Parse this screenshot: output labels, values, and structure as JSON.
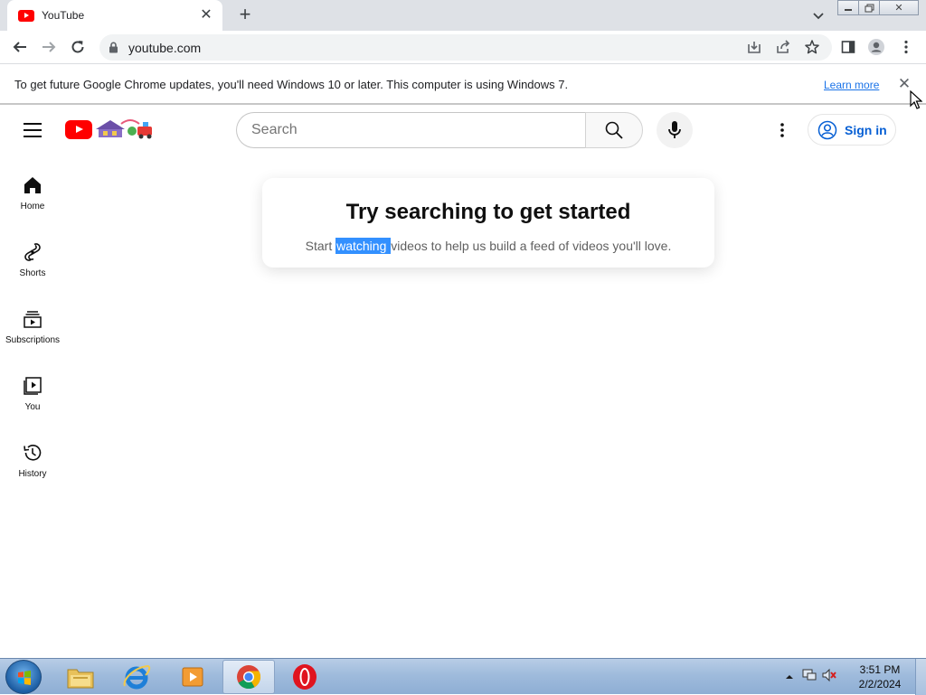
{
  "browser": {
    "tab": {
      "title": "YouTube"
    },
    "address": {
      "url": "youtube.com"
    }
  },
  "infobar": {
    "message": "To get future Google Chrome updates, you'll need Windows 10 or later. This computer is using Windows 7.",
    "learn_more": "Learn more"
  },
  "youtube": {
    "search": {
      "placeholder": "Search"
    },
    "sign_in": "Sign in",
    "nav": [
      {
        "label": "Home",
        "icon": "home-icon"
      },
      {
        "label": "Shorts",
        "icon": "shorts-icon"
      },
      {
        "label": "Subscriptions",
        "icon": "subscriptions-icon"
      },
      {
        "label": "You",
        "icon": "you-icon"
      },
      {
        "label": "History",
        "icon": "history-icon"
      }
    ],
    "card": {
      "title": "Try searching to get started",
      "sub_before": "Start ",
      "sub_selected": "watching ",
      "sub_after": "videos to help us build a feed of videos you'll love."
    }
  },
  "taskbar": {
    "time": "3:51 PM",
    "date": "2/2/2024",
    "apps": [
      "file-explorer",
      "internet-explorer",
      "media-player",
      "chrome",
      "opera"
    ]
  },
  "colors": {
    "youtube_red": "#ff0000",
    "link_blue": "#065fd4",
    "selection": "#3390ff"
  }
}
